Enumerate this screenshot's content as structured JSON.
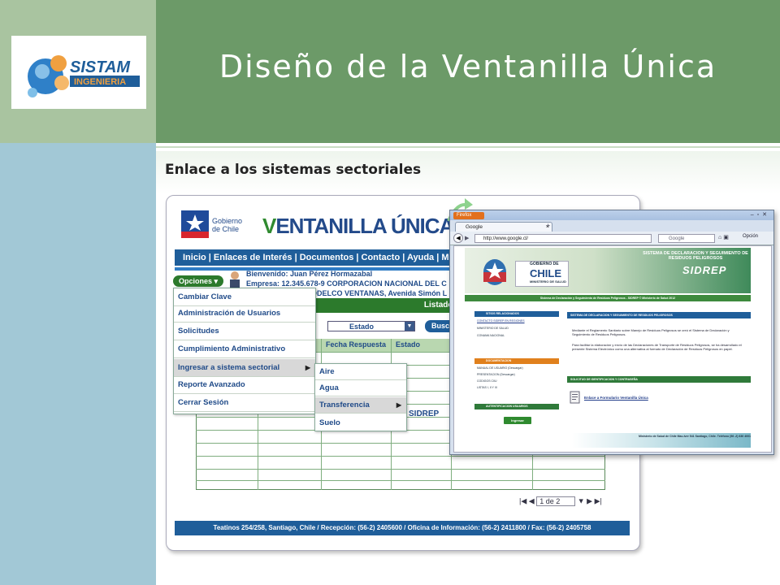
{
  "slide": {
    "title": "Diseño de la Ventanilla Única",
    "subtitle": "Enlace a los sistemas sectoriales",
    "logo": {
      "name": "SISTAM",
      "sub": "INGENIERIA"
    }
  },
  "portal": {
    "gov_label": "Gobierno de Chile",
    "brand_first": "V",
    "brand_rest": "ENTANILLA ÚNICA DEL",
    "nav": "Inicio | Enlaces de Interés | Documentos | Contacto | Ayuda | M",
    "welcome_label": "Bienvenido:",
    "welcome_name": "Juan Pérez Hormazabal",
    "empresa_label": "Empresa:",
    "empresa_value": "12.345.678-9 CORPORACION NACIONAL DEL C",
    "address_value": "ODELCO VENTANAS, Avenida Simón L",
    "opciones_button": "Opciones",
    "listado_title": "Listado de Solicitudes",
    "estado_select": "Estado",
    "buscar_button": "Busc",
    "columns": [
      "Fecha Respuesta",
      "Estado"
    ],
    "sidrep_cell": "SIDREP",
    "pager_value": "1 de 2",
    "footer": "Teatinos 254/258, Santiago, Chile / Recepción: (56-2) 2405600 / Oficina de Información: (56-2) 2411800 / Fax: (56-2) 2405758"
  },
  "menu": {
    "items": [
      "Cambiar Clave",
      "Administración de Usuarios",
      "Solicitudes",
      "Cumplimiento Administrativo",
      "Ingresar a sistema sectorial",
      "Reporte Avanzado",
      "Cerrar Sesión"
    ],
    "submenu": [
      "Aire",
      "Agua",
      "Transferencia",
      "Suelo"
    ]
  },
  "browser": {
    "firefox_label": "Firefox",
    "tab_title": "Google",
    "new_tab": "+",
    "url": "http://www.google.cl/",
    "search_placeholder": "Google",
    "opcion_label": "Opción",
    "page": {
      "gob_label": "GOBIERNO DE",
      "chile_label": "CHILE",
      "minsal_label": "MINISTERIO DE SALUD",
      "system_name": "SISTEMA DE DECLARACION Y SEGUIMIENTO DE RESIDUOS PELIGROSOS",
      "sidrep": "SIDREP",
      "strip": "Sistema de Declaración y Seguimiento de Residuos Peligrosos - SIDREP © Ministerio de Salud 2012",
      "box1_title": "SITIOS RELACIONADOS",
      "box1_links": [
        "CONTACTO SIDREP EN REGIONES",
        "MINISTERIO DE SALUD",
        "CONAMA NACIONAL"
      ],
      "box2_title": "DOCUMENTACION",
      "box2_links": [
        "MANUAL DE USUARIO (Descargar)",
        "PRESENTACION (Descargar)",
        "CODIGOS CIIU",
        "LISTAS I, II Y III"
      ],
      "box3_title": "AUTENTIFICACION USUARIOS",
      "ingresar": "Ingresar",
      "right_title": "SISTEMA DE DECLARACION Y SEGUIMIENTO DE RESIDUOS PELIGROSOS",
      "p1": "Mediante el Reglamento Sanitario sobre Manejo de Residuos Peligrosos se creó el Sistema de Declaración y Seguimiento de Residuos Peligrosos.",
      "p2": "Para facilitar la elaboración y envío de las Declaraciones de Transporte de Residuos Peligrosos, se ha desarrollado el presente Sistema Electrónico como una alternativa al formato de Declaración de Residuos Peligrosos en papel.",
      "solicitud_title": "SOLICITUD DE IDENTIFICACION Y CONTRASEÑA",
      "enlace": "Enlace a Formulario Ventanilla Única",
      "footer": "Ministerio de Salud de Chile Mac-Iver 541 Santiago, Chile. Teléfono (56 -2) 630 4001"
    }
  }
}
